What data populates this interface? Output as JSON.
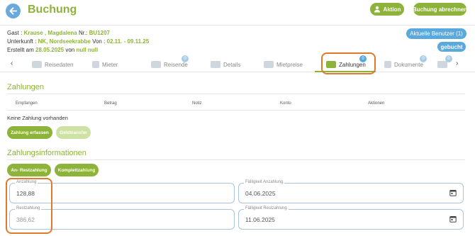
{
  "header": {
    "title": "Buchung",
    "aktion_label": "Aktion",
    "abrechnen_label": "Buchung abrechnen"
  },
  "info": {
    "gast_label": "Gast :",
    "gast_value": "Krause , Magdalena",
    "nr_label": "Nr.:",
    "nr_value": "BU1207",
    "unterkunft_label": "Unterkunft :",
    "unterkunft_value": "NK, Nordseekrabbe",
    "von_label": "Von :",
    "von_value": "02.11. - 09.11.25",
    "erstellt_label": "Erstellt am",
    "erstellt_date": "28.05.2025",
    "erstellt_von_label": "von",
    "erstellt_von_value": "null null"
  },
  "status": {
    "aktuelle_benutzer": "Aktuelle Benutzer (1)",
    "gebucht": "gebucht"
  },
  "tabs": [
    {
      "label": "Reisedaten",
      "icon": "people-icon"
    },
    {
      "label": "Mieter",
      "icon": "person-icon"
    },
    {
      "label": "Reisende",
      "icon": "group-icon",
      "badge": "0"
    },
    {
      "label": "Details",
      "icon": "details-icon"
    },
    {
      "label": "Mietpreise",
      "icon": "price-icon"
    },
    {
      "label": "Zahlungen",
      "icon": "payment-icon",
      "badge": "0",
      "active": true
    },
    {
      "label": "Dokumente",
      "icon": "document-icon",
      "badge": "0"
    },
    {
      "label": "",
      "icon": "chat-icon",
      "badge": "0"
    }
  ],
  "zahlungen": {
    "title": "Zahlungen",
    "columns": [
      "Empfangen",
      "Betrag",
      "Notiz",
      "Konto",
      "Aktionen"
    ],
    "empty_text": "Keine Zahlung vorhanden",
    "erfassen_label": "Zahlung erfassen",
    "geldtransfer_label": "Geldtransfer"
  },
  "zahlungsinfo": {
    "title": "Zahlungsinformationen",
    "restzahlung_btn": "An- Restzahlung",
    "komplett_btn": "Komplettzahlung",
    "anzahlung_label": "Anzahlung",
    "anzahlung_value": "128,88",
    "faelligkeit_anzahlung_label": "Fälligkeit Anzahlung",
    "faelligkeit_anzahlung_value": "04.06.2025",
    "restzahlung_label": "Restzahlung",
    "restzahlung_value": "386,62",
    "faelligkeit_rest_label": "Fälligkeit Restzahlung",
    "faelligkeit_rest_value": "11.06.2025"
  },
  "colors": {
    "brand_green": "#8db33a",
    "accent_blue": "#5aa9dd",
    "highlight_orange": "#e07a2a"
  }
}
